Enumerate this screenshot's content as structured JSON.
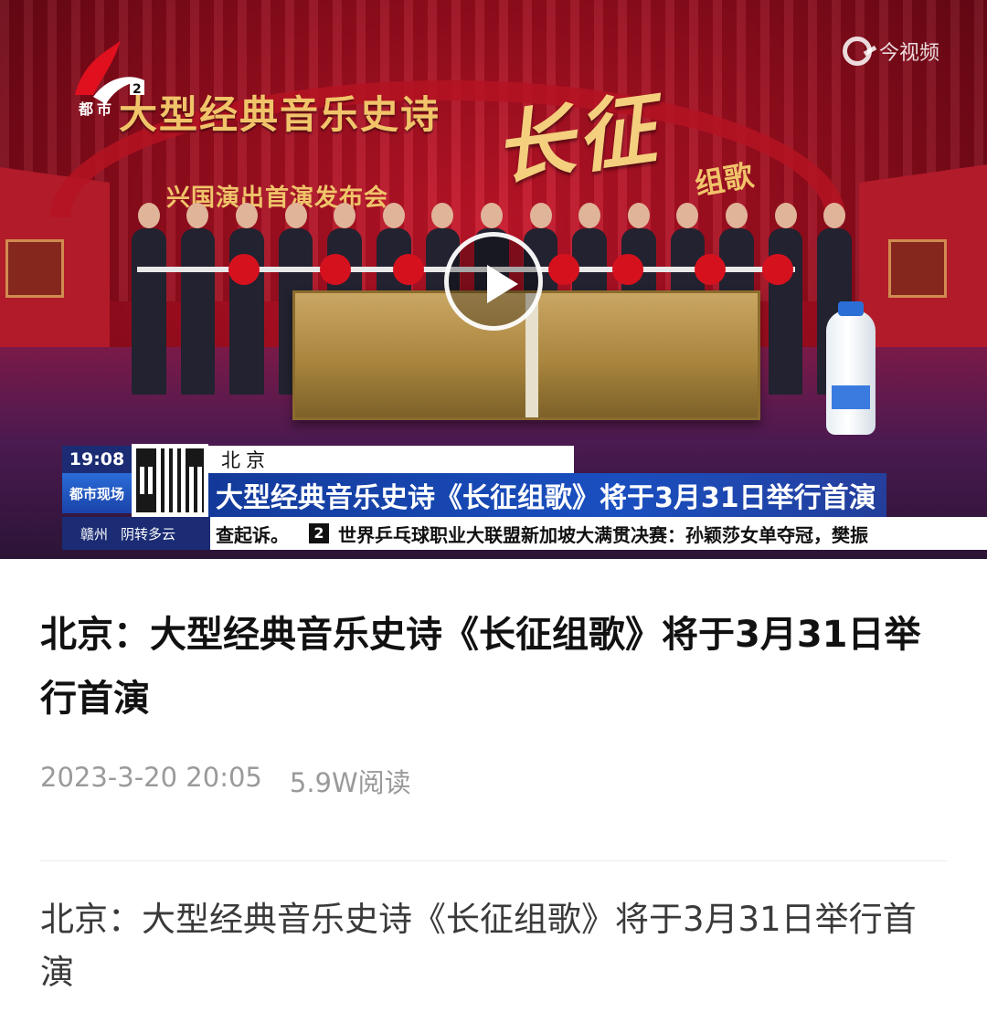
{
  "video": {
    "stage_title": "大型经典音乐史诗",
    "stage_calligraphy": "长征",
    "stage_sub": "组歌",
    "stage_subtitle": "兴国演出首演发布会",
    "channel_logo_text": "都市",
    "channel_number": "2",
    "watermark": "今视频",
    "play_icon": "play-icon"
  },
  "ticker": {
    "time": "19:08",
    "badge": "都市现场",
    "location": "北京",
    "headline": "大型经典音乐史诗《长征组歌》将于3月31日举行首演",
    "weather_city": "赣州",
    "weather_desc": "阴转多云",
    "scroll_prefix": "查起诉。",
    "scroll_num": "2",
    "scroll_text": "世界乒乓球职业大联盟新加坡大满贯决赛：孙颖莎女单夺冠，樊振"
  },
  "article": {
    "title": "北京：大型经典音乐史诗《长征组歌》将于3月31日举行首演",
    "date": "2023-3-20 20:05",
    "reads": "5.9W阅读",
    "body": "北京：大型经典音乐史诗《长征组歌》将于3月31日举行首演"
  },
  "colors": {
    "ticker_blue": "#1a4fc0",
    "meta_gray": "#9a9a9a",
    "curtain_red": "#c8162a"
  }
}
